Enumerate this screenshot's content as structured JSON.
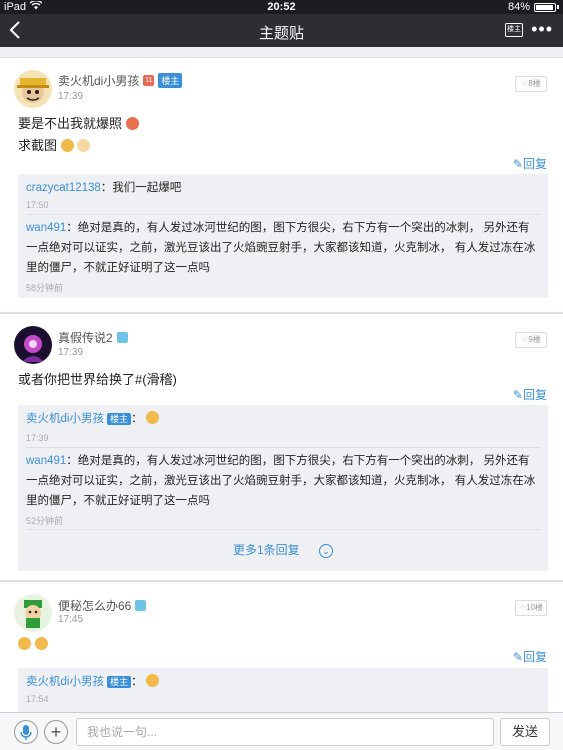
{
  "status_bar": {
    "device": "iPad",
    "time": "20:52",
    "battery": "84%",
    "battery_level": 0.84
  },
  "nav": {
    "title": "主题贴",
    "owner_filter_label": "楼主"
  },
  "posts": [
    {
      "author": "卖火机di小男孩",
      "level": "11",
      "owner_badge": "楼主",
      "time": "17:39",
      "floor": "8楼",
      "lines": [
        "要是不出我就爆照",
        "求截图"
      ],
      "reply_label": "回复",
      "replies": [
        {
          "user": "crazycat12138",
          "sep": "：",
          "text": "我们一起爆吧",
          "time": "17:50"
        },
        {
          "user": "wan491",
          "sep": "：",
          "text": "绝对是真的，有人发过冰河世纪的图，图下方很尖，右下方有一个突出的冰刺， 另外还有一点绝对可以证实，之前，激光豆该出了火焰豌豆射手，大家都该知道，火克制冰， 有人发过冻在冰里的僵尸，不就正好证明了这一点吗",
          "time": "58分钟前"
        }
      ]
    },
    {
      "author": "真假传说2",
      "time": "17:39",
      "floor": "9楼",
      "lines": [
        "或者你把世界给换了#(滑稽)"
      ],
      "reply_label": "回复",
      "replies": [
        {
          "user": "卖火机di小男孩",
          "owner_badge": "楼主",
          "sep": "：",
          "time": "17:39"
        },
        {
          "user": "wan491",
          "sep": "：",
          "text": "绝对是真的，有人发过冰河世纪的图，图下方很尖，右下方有一个突出的冰刺， 另外还有一点绝对可以证实，之前，激光豆该出了火焰豌豆射手，大家都该知道，火克制冰， 有人发过冻在冰里的僵尸，不就正好证明了这一点吗",
          "time": "52分钟前"
        }
      ],
      "more_replies": "更多1条回复"
    },
    {
      "author": "便秘怎么办66",
      "time": "17:45",
      "floor": "10楼",
      "reply_label": "回复",
      "replies": [
        {
          "user": "卖火机di小男孩",
          "owner_badge": "楼主",
          "sep": "：",
          "time": "17:54"
        }
      ]
    }
  ],
  "input": {
    "placeholder": "我也说一句...",
    "send_label": "发送"
  }
}
